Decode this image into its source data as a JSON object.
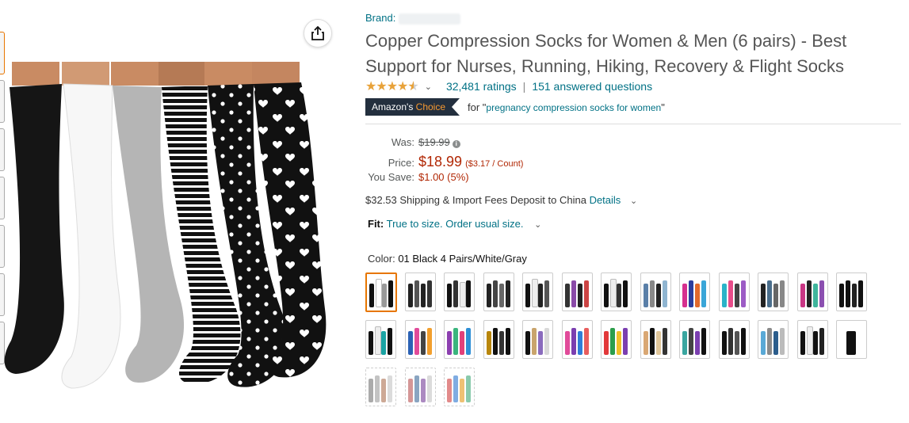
{
  "share": {
    "icon": "share-icon"
  },
  "thumbnails": [
    {
      "active": true
    },
    {
      "active": false
    },
    {
      "active": false
    },
    {
      "active": false
    },
    {
      "active": false
    },
    {
      "active": false
    },
    {
      "active": false
    }
  ],
  "product": {
    "brand_label": "Brand:",
    "title": "Copper Compression Socks for Women & Men (6 pairs) - Best Support for Nurses, Running, Hiking, Recovery & Flight Socks",
    "rating_value": 4.5,
    "ratings_text": "32,481 ratings",
    "answered_text": "151 answered questions",
    "choice_prefix": "Amazon's",
    "choice_word": "Choice",
    "choice_for": "for \"",
    "choice_query": "pregnancy compression socks for women",
    "choice_close": "\""
  },
  "price": {
    "was_label": "Was:",
    "was_value": "$19.99",
    "price_label": "Price:",
    "price_value": "$18.99",
    "unit_price": "($3.17 / Count)",
    "save_label": "You Save:",
    "save_value": "$1.00 (5%)"
  },
  "shipping": {
    "text": "$32.53 Shipping & Import Fees Deposit to China ",
    "details": "Details"
  },
  "fit": {
    "label": "Fit:",
    "value": "True to size. Order usual size."
  },
  "color": {
    "label": "Color:",
    "value": "01 Black 4 Pairs/White/Gray"
  },
  "swatches": [
    {
      "colors": [
        "#111",
        "#fff",
        "#999",
        "#111"
      ],
      "selected": true,
      "available": true
    },
    {
      "colors": [
        "#222",
        "#555",
        "#222",
        "#333"
      ],
      "selected": false,
      "available": true
    },
    {
      "colors": [
        "#111",
        "#333",
        "#eee",
        "#111"
      ],
      "selected": false,
      "available": true
    },
    {
      "colors": [
        "#222",
        "#444",
        "#666",
        "#222"
      ],
      "selected": false,
      "available": true
    },
    {
      "colors": [
        "#111",
        "#eee",
        "#222",
        "#555"
      ],
      "selected": false,
      "available": true
    },
    {
      "colors": [
        "#333",
        "#8a4aa8",
        "#222",
        "#c44"
      ],
      "selected": false,
      "available": true
    },
    {
      "colors": [
        "#111",
        "#eee",
        "#333",
        "#111"
      ],
      "selected": false,
      "available": true
    },
    {
      "colors": [
        "#5a7fa8",
        "#888",
        "#222",
        "#8fb5d1"
      ],
      "selected": false,
      "available": true
    },
    {
      "colors": [
        "#d62f8f",
        "#2c3e9e",
        "#e26a2c",
        "#3aa6d8"
      ],
      "selected": false,
      "available": true
    },
    {
      "colors": [
        "#2bb3c8",
        "#e84d8a",
        "#444",
        "#9c5cc5"
      ],
      "selected": false,
      "available": true
    },
    {
      "colors": [
        "#222",
        "#4a6e8c",
        "#666",
        "#888"
      ],
      "selected": false,
      "available": true
    },
    {
      "colors": [
        "#c93684",
        "#222",
        "#3fb59c",
        "#8b4fb0"
      ],
      "selected": false,
      "available": true
    },
    {
      "colors": [
        "#111",
        "#111",
        "#222",
        "#111"
      ],
      "selected": false,
      "available": true
    },
    {
      "colors": [
        "#111",
        "#eee",
        "#1aa3a3",
        "#111"
      ],
      "selected": false,
      "available": true
    },
    {
      "colors": [
        "#2b62b5",
        "#e14b9a",
        "#444",
        "#f29f2d"
      ],
      "selected": false,
      "available": true
    },
    {
      "colors": [
        "#8c3fb0",
        "#3ab57e",
        "#e2407a",
        "#2e8fd6"
      ],
      "selected": false,
      "available": true
    },
    {
      "colors": [
        "#b8860b",
        "#111",
        "#333",
        "#111"
      ],
      "selected": false,
      "available": true
    },
    {
      "colors": [
        "#111",
        "#c9a46c",
        "#8a6bbd",
        "#d9d9d9"
      ],
      "selected": false,
      "available": true
    },
    {
      "colors": [
        "#e14b9a",
        "#7b3fb0",
        "#2f7ed8",
        "#e85d5d"
      ],
      "selected": false,
      "available": true
    },
    {
      "colors": [
        "#e2383a",
        "#2c9e4b",
        "#f2c028",
        "#7b3fb0"
      ],
      "selected": false,
      "available": true
    },
    {
      "colors": [
        "#d9a773",
        "#111",
        "#e0c69a",
        "#333"
      ],
      "selected": false,
      "available": true
    },
    {
      "colors": [
        "#3aa6a0",
        "#444",
        "#7b3fb0",
        "#111"
      ],
      "selected": false,
      "available": true
    },
    {
      "colors": [
        "#111",
        "#333",
        "#555",
        "#111"
      ],
      "selected": false,
      "available": true
    },
    {
      "colors": [
        "#5aa9d6",
        "#8a8a8a",
        "#2b5d8c",
        "#bbb"
      ],
      "selected": false,
      "available": true
    },
    {
      "colors": [
        "#111",
        "#eee",
        "#111",
        "#222"
      ],
      "selected": false,
      "available": true
    },
    {
      "colors": [
        "#111"
      ],
      "selected": false,
      "available": true
    },
    {
      "colors": [
        "#888",
        "#aaa",
        "#b8866b",
        "#ccc"
      ],
      "selected": false,
      "available": false
    },
    {
      "colors": [
        "#c46a6a",
        "#5a7fa8",
        "#8a5aa8",
        "#ccc"
      ],
      "selected": false,
      "available": false
    },
    {
      "colors": [
        "#d65a5a",
        "#4a8ad6",
        "#e8a83a",
        "#5ab58a"
      ],
      "selected": false,
      "available": false
    }
  ]
}
